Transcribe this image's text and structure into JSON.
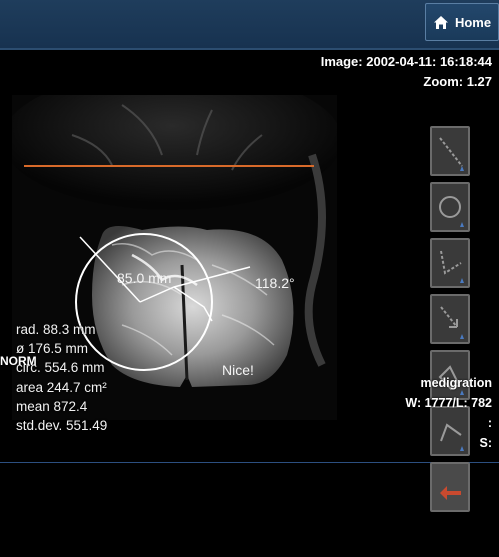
{
  "header": {
    "home_label": "Home"
  },
  "image_info": {
    "datetime": "Image: 2002-04-11: 16:18:44",
    "zoom": "Zoom: 1.27"
  },
  "measurement": {
    "radius": "rad. 88.3 mm",
    "diameter": "ø 176.5 mm",
    "circumference": "circ. 554.6 mm",
    "area": "area 244.7 cm²",
    "mean": "mean 872.4",
    "std_dev": "std.dev. 551.49"
  },
  "overlay": {
    "norm": "NORM",
    "distance_label": "85.0 mm",
    "angle_label": "118.2°",
    "note": "Nice!",
    "colors": {
      "ruler": "#d86a2a",
      "annotation": "#ffffff"
    }
  },
  "window_info": {
    "preset": "medigration",
    "window_level": "W: 1777/L: 782",
    "colon": ":",
    "s_label": "S:"
  },
  "tools": [
    {
      "icon": "line-measure-icon"
    },
    {
      "icon": "circle-measure-icon"
    },
    {
      "icon": "angle-measure-icon"
    },
    {
      "icon": "arrow-annotation-icon"
    },
    {
      "icon": "polygon-measure-icon"
    },
    {
      "icon": "polyline-measure-icon"
    },
    {
      "icon": "undo-icon"
    }
  ]
}
